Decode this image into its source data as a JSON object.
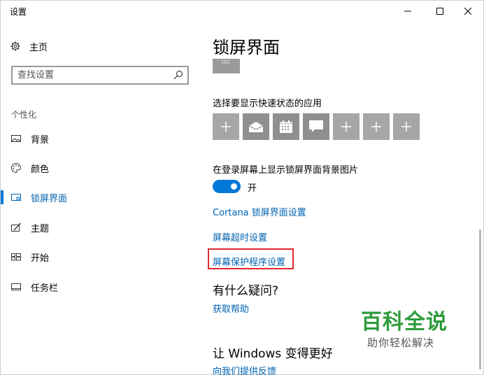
{
  "window": {
    "title": "设置"
  },
  "sidebar": {
    "home_label": "主页",
    "search_placeholder": "查找设置",
    "section_label": "个性化",
    "items": [
      {
        "label": "背景",
        "icon": "picture-icon"
      },
      {
        "label": "颜色",
        "icon": "palette-icon"
      },
      {
        "label": "锁屏界面",
        "icon": "lock-screen-icon",
        "active": true
      },
      {
        "label": "主题",
        "icon": "theme-brush-icon"
      },
      {
        "label": "开始",
        "icon": "start-grid-icon"
      },
      {
        "label": "任务栏",
        "icon": "taskbar-icon"
      }
    ]
  },
  "main": {
    "title": "锁屏界面",
    "quick_status_label": "选择要显示快速状态的应用",
    "quick_tiles": [
      "plus-icon",
      "mail-icon",
      "calendar-icon",
      "message-icon",
      "plus-icon",
      "plus-icon",
      "plus-icon"
    ],
    "background_on_signin_label": "在登录屏幕上显示锁屏界面背景图片",
    "toggle_state": "开",
    "toggle_on": true,
    "links": {
      "cortana": "Cortana 锁屏界面设置",
      "screen_timeout": "屏幕超时设置",
      "screen_saver": "屏幕保护程序设置"
    },
    "questions_title": "有什么疑问?",
    "get_help": "获取帮助",
    "improve_title": "让 Windows 变得更好",
    "feedback": "向我们提供反馈"
  },
  "watermark": {
    "title": "百科全说",
    "subtitle": "助你轻松解决"
  },
  "colors": {
    "accent": "#0078d7",
    "link": "#0063b1",
    "highlight_box": "#e0292b",
    "tile": "#a6a6a6",
    "watermark_green": "#2e9b3b"
  }
}
